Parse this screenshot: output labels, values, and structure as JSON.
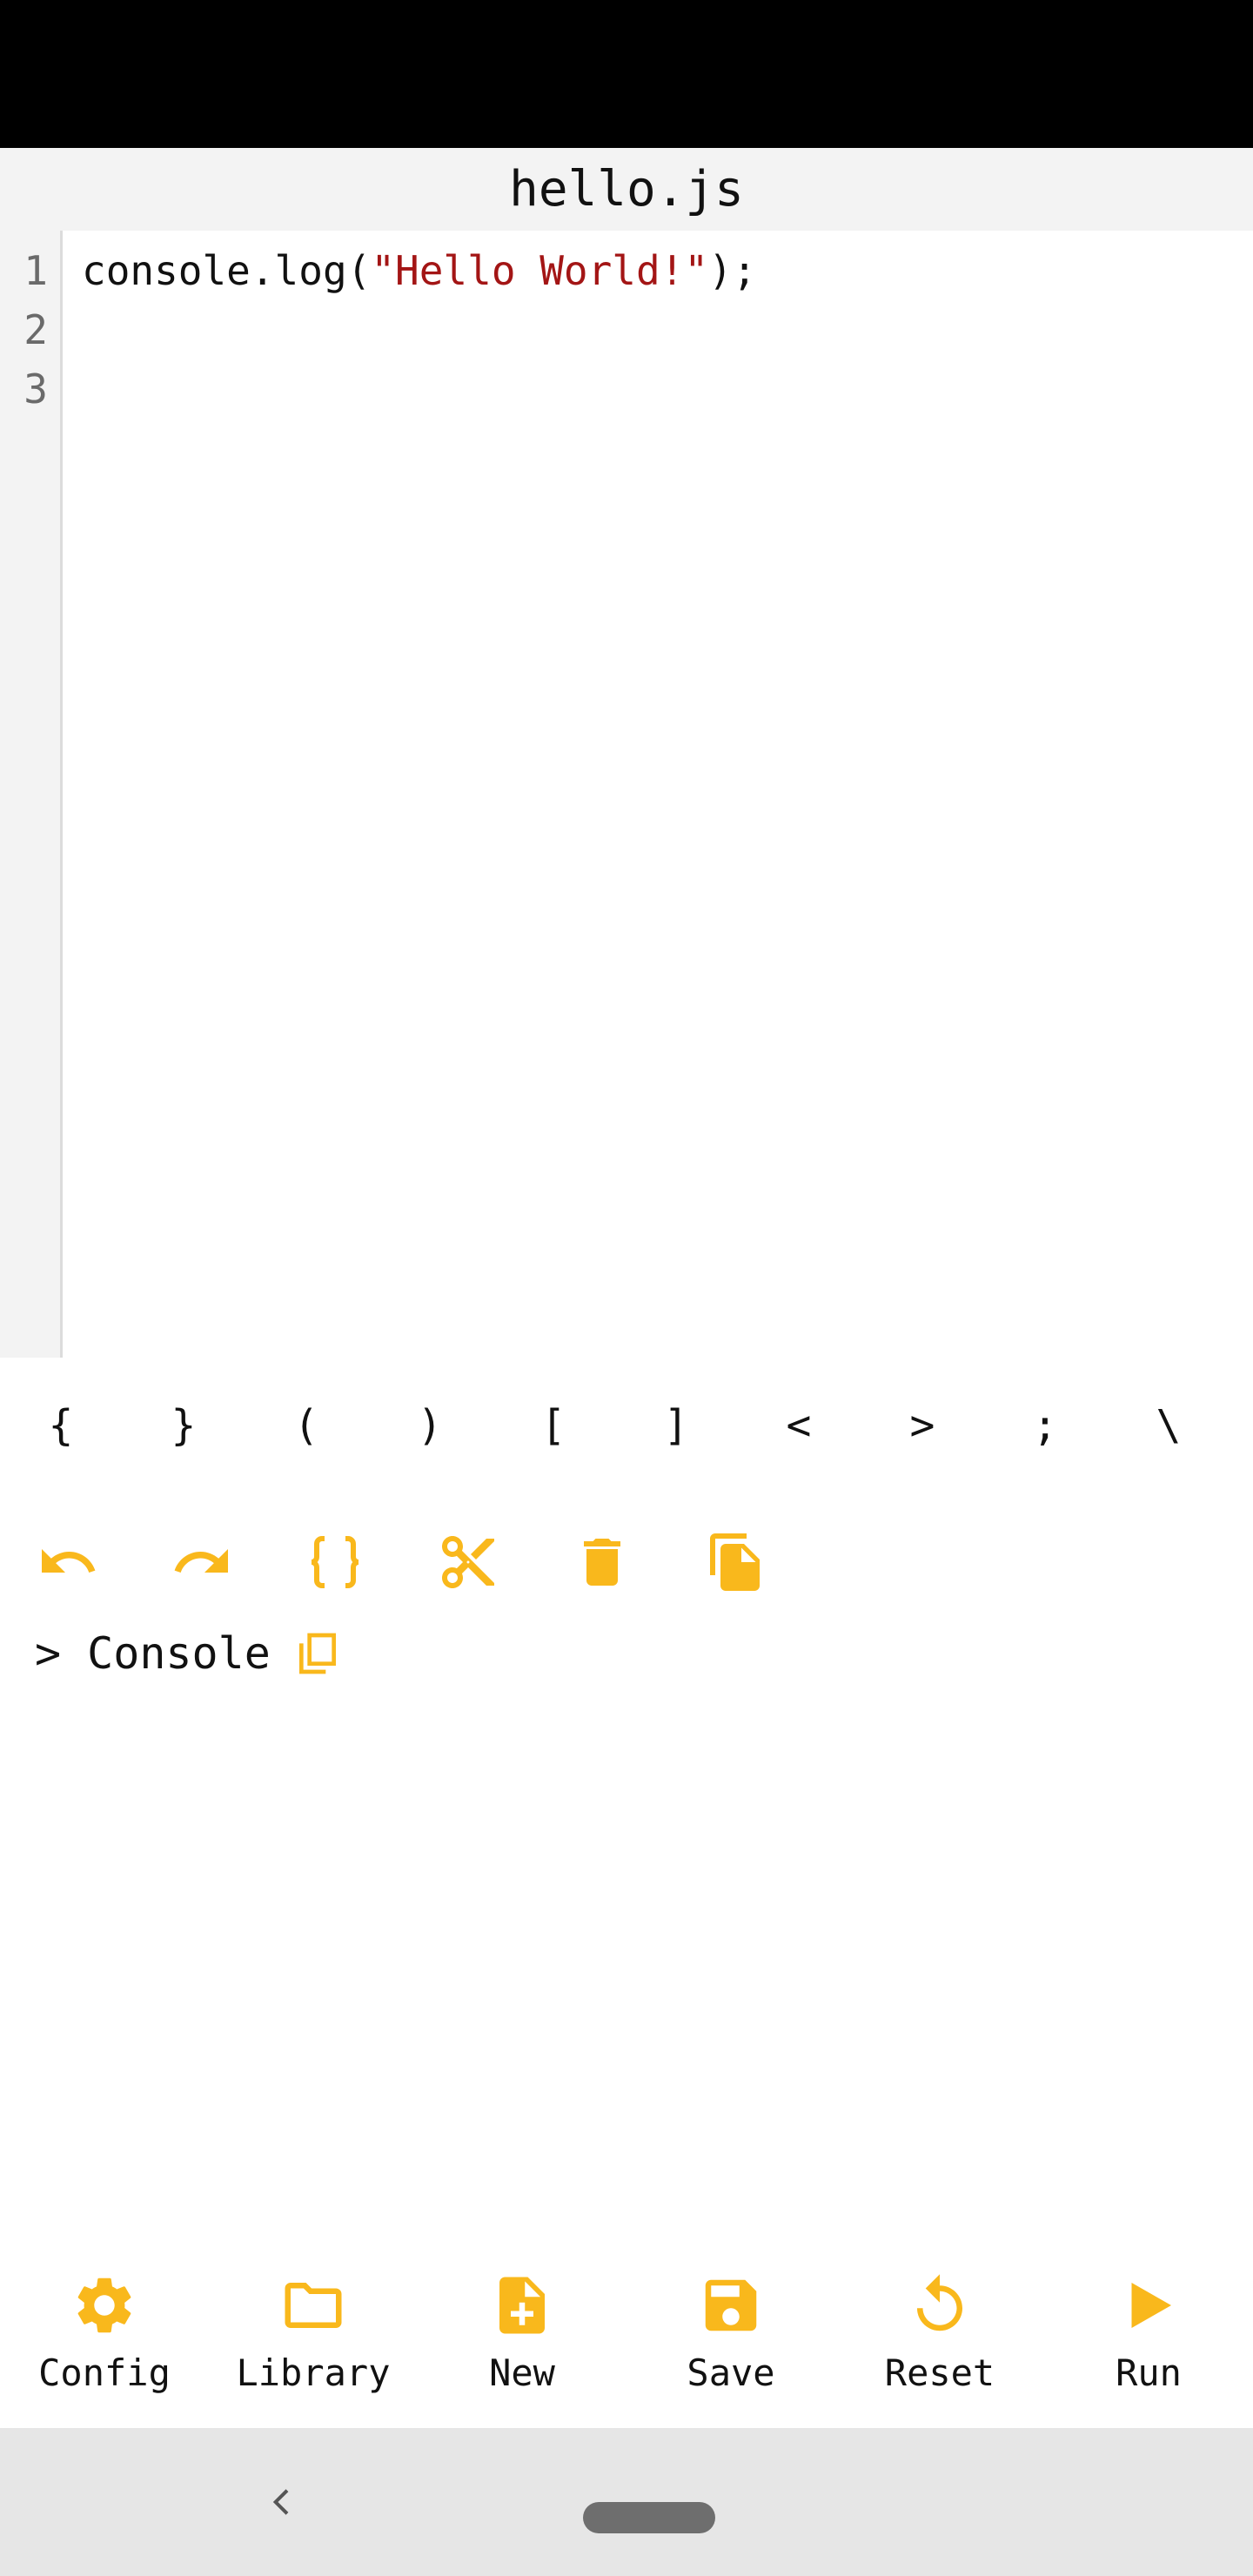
{
  "accent_color": "#F9B81C",
  "file": {
    "title": "hello.js"
  },
  "editor": {
    "line_numbers": [
      "1",
      "2",
      "3"
    ],
    "lines": [
      {
        "before": "console.log(",
        "string": "\"Hello World!\"",
        "after": ");"
      },
      {
        "before": "",
        "string": "",
        "after": ""
      },
      {
        "before": "",
        "string": "",
        "after": ""
      }
    ]
  },
  "symbols": [
    "{",
    "}",
    "(",
    ")",
    "[",
    "]",
    "<",
    ">",
    ";",
    "\\"
  ],
  "toolbar": {
    "icons": [
      "undo-icon",
      "redo-icon",
      "format-braces-icon",
      "cut-icon",
      "delete-icon",
      "paste-icon"
    ]
  },
  "console": {
    "prompt": ">",
    "label": "Console",
    "icon": "copy-icon"
  },
  "bottom_nav": [
    {
      "label": "Config",
      "icon": "gear-icon"
    },
    {
      "label": "Library",
      "icon": "folder-icon"
    },
    {
      "label": "New",
      "icon": "new-file-icon"
    },
    {
      "label": "Save",
      "icon": "save-icon"
    },
    {
      "label": "Reset",
      "icon": "reset-icon"
    },
    {
      "label": "Run",
      "icon": "play-icon"
    }
  ]
}
